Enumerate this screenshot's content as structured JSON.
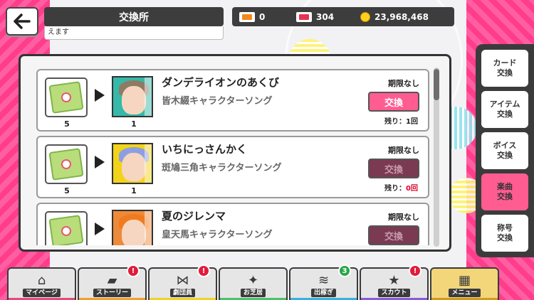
{
  "header": {
    "title": "交換所",
    "subtitle": "えます",
    "back_icon": "back-arrow-icon"
  },
  "currencies": [
    {
      "icon": "orange-ticket-icon",
      "value": "0"
    },
    {
      "icon": "red-ticket-icon",
      "value": "304"
    },
    {
      "icon": "coin-icon",
      "value": "23,968,468"
    }
  ],
  "exchange_items": [
    {
      "title": "ダンデライオンのあくび",
      "subtitle": "皆木綴キャラクターソング",
      "deadline": "期限なし",
      "cost": "5",
      "reward_count": "1",
      "button_label": "交換",
      "button_state": "active",
      "remaining_label": "残り：",
      "remaining_value": "1回"
    },
    {
      "title": "いちにっさんかく",
      "subtitle": "斑鳩三角キャラクターソング",
      "deadline": "期限なし",
      "cost": "5",
      "reward_count": "1",
      "button_label": "交換",
      "button_state": "disabled",
      "remaining_label": "残り：",
      "remaining_value": "0回"
    },
    {
      "title": "夏のジレンマ",
      "subtitle": "皇天馬キャラクターソング",
      "deadline": "期限なし",
      "cost": "",
      "reward_count": "",
      "button_label": "交換",
      "button_state": "disabled",
      "remaining_label": "",
      "remaining_value": ""
    }
  ],
  "category_tabs": [
    {
      "line1": "カード",
      "line2": "交換",
      "active": false
    },
    {
      "line1": "アイテム",
      "line2": "交換",
      "active": false
    },
    {
      "line1": "ボイス",
      "line2": "交換",
      "active": false
    },
    {
      "line1": "楽曲",
      "line2": "交換",
      "active": true
    },
    {
      "line1": "称号",
      "line2": "交換",
      "active": false
    }
  ],
  "bottom_nav": [
    {
      "label": "マイページ",
      "icon": "house-icon",
      "badge": "",
      "color": "#e64a7a"
    },
    {
      "label": "ストーリー",
      "icon": "book-icon",
      "badge": "!",
      "color": "#f0a030"
    },
    {
      "label": "劇団員",
      "icon": "bowtie-icon",
      "badge": "!",
      "color": "#f2d22a"
    },
    {
      "label": "お芝居",
      "icon": "stage-icon",
      "badge": "",
      "color": "#4cc26a"
    },
    {
      "label": "出稼ぎ",
      "icon": "coins-icon",
      "badge": "3",
      "color": "#3ab0e0"
    },
    {
      "label": "スカウト",
      "icon": "star-badge-icon",
      "badge": "!",
      "color": "#8a5ad8"
    },
    {
      "label": "メニュー",
      "icon": "grid-icon",
      "badge": "",
      "color": "#d09a20"
    }
  ]
}
